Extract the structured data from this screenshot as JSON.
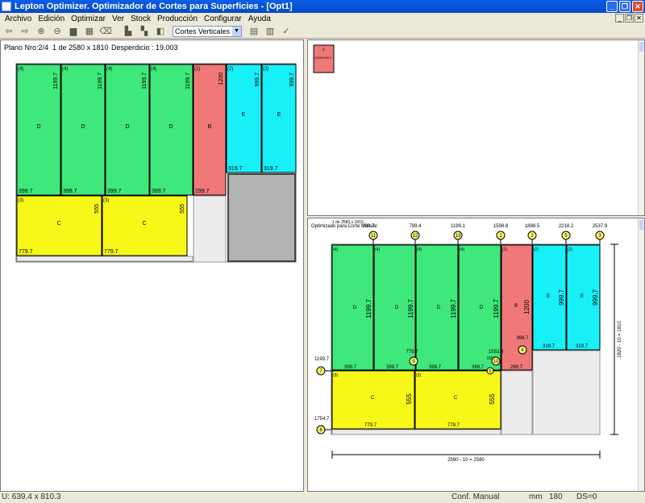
{
  "window": {
    "title": "Lepton Optimizer. Optimizador de Cortes para Superficies - [Opt1]",
    "controls": [
      "_",
      "❐",
      "✕"
    ]
  },
  "menu": [
    "Archivo",
    "Edición",
    "Optimizar",
    "Ver",
    "Stock",
    "Producción",
    "Configurar",
    "Ayuda"
  ],
  "toolbar": {
    "view_select": "Cortes Verticales",
    "icons": [
      "back-arrow-icon",
      "forward-arrow-icon",
      "zoom-in-icon",
      "zoom-out-icon",
      "folder-icon",
      "film-icon",
      "eraser-icon",
      "piece-icon",
      "piece-stack-icon",
      "layout-icon",
      "grid-icon",
      "split-icon",
      "checkmark-icon"
    ]
  },
  "plan": {
    "header_plano": "Plano Nro:2/4",
    "header_count": "1 de 2580 x 1810",
    "header_desperdicio": "Desperdicio : 19.003"
  },
  "colors": {
    "D": "#3ee87a",
    "B": "#f07878",
    "E": "#18f0f8",
    "C": "#f8f818",
    "waste": "#b3b3b3",
    "light": "#ececec"
  },
  "pieces_left": [
    {
      "label": "D",
      "count": "(4)",
      "h": "1199.7",
      "w": "399.7"
    },
    {
      "label": "D",
      "count": "(4)",
      "h": "1199.7",
      "w": "399.7"
    },
    {
      "label": "D",
      "count": "(4)",
      "h": "1199.7",
      "w": "399.7"
    },
    {
      "label": "D",
      "count": "(4)",
      "h": "1199.7",
      "w": "399.7"
    },
    {
      "label": "B",
      "count": "(2)",
      "h": "1200",
      "w": "299.7"
    },
    {
      "label": "E",
      "count": "(2)",
      "h": "999.7",
      "w": "319.7"
    },
    {
      "label": "E",
      "count": "(2)",
      "h": "999.7",
      "w": "319.7"
    },
    {
      "label": "C",
      "count": "(3)",
      "h": "555",
      "w": "779.7"
    },
    {
      "label": "C",
      "count": "(3)",
      "h": "555",
      "w": "779.7"
    }
  ],
  "thumb": {
    "num": "1",
    "text": "2000X799.7"
  },
  "detail": {
    "caption": "Optimizado para Corte Manual",
    "caption_over": "1 de 2580 x 1810",
    "top_dims": [
      "799.4",
      "1199.1",
      "1598.8",
      "1898.5",
      "2218.2",
      "2537.9"
    ],
    "top_first": "399.7",
    "top_markers": [
      "11",
      "12",
      "13",
      "1",
      "2",
      "5",
      "3"
    ],
    "left_dims": [
      "1199.7",
      "1754.7"
    ],
    "left_markers": [
      "7",
      "8"
    ],
    "inner_markers": [
      "9",
      "10",
      "4",
      "6"
    ],
    "inner_dims": [
      "779.7",
      "1553.4",
      "1554",
      "999.7"
    ],
    "bottom_dim": "2590 - 10 = 2580",
    "right_dim": "1820 - 10 = 1810"
  },
  "status": {
    "coords": "U: 639.4 x 810.3",
    "mode": "Conf. Manual",
    "unit": "mm",
    "value": "180",
    "ds": "DS=0"
  }
}
